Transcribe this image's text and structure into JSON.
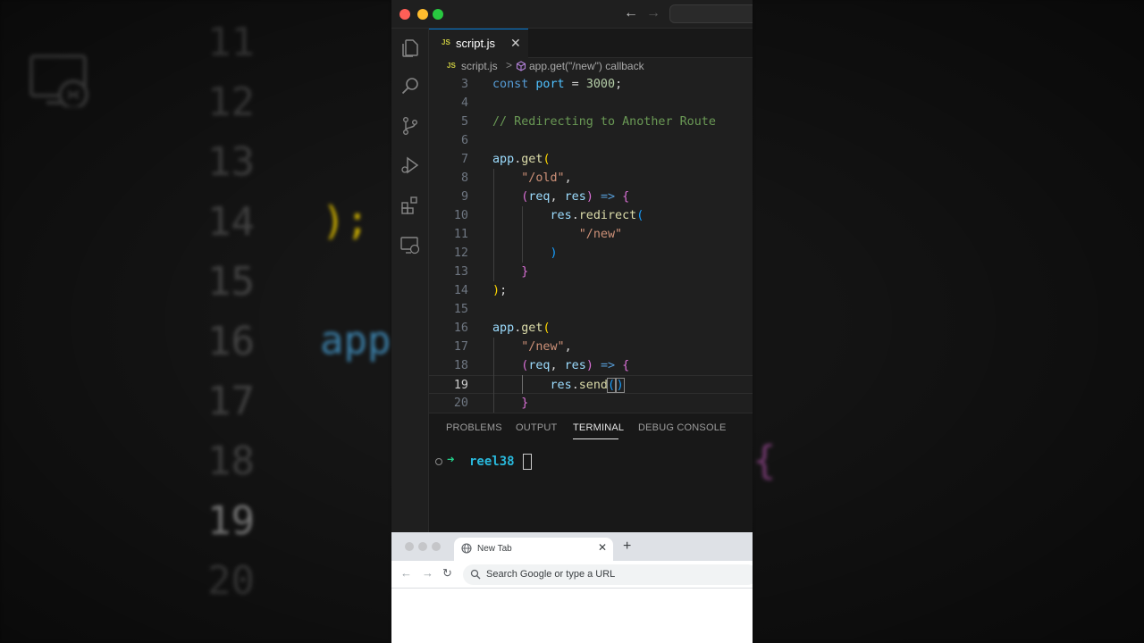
{
  "vscode": {
    "tab_label": "script.js",
    "tab_file_badge": "JS",
    "breadcrumb": {
      "file_badge": "JS",
      "file": "script.js",
      "separator": ">",
      "symbol": "app.get(\"/new\") callback"
    },
    "current_line": 19,
    "code_lines": [
      {
        "n": 3,
        "tokens": [
          [
            "const ",
            "#569cd6"
          ],
          [
            "port",
            "#4fc1ff"
          ],
          [
            " = ",
            "#d4d4d4"
          ],
          [
            "3000",
            "#b5cea8"
          ],
          [
            ";",
            "#d4d4d4"
          ]
        ]
      },
      {
        "n": 4,
        "tokens": []
      },
      {
        "n": 5,
        "tokens": [
          [
            "// Redirecting to Another Route",
            "#6a9955"
          ]
        ]
      },
      {
        "n": 6,
        "tokens": []
      },
      {
        "n": 7,
        "tokens": [
          [
            "app",
            "#9cdcfe"
          ],
          [
            ".",
            "#d4d4d4"
          ],
          [
            "get",
            "#dcdcaa"
          ],
          [
            "(",
            "#ffd700"
          ]
        ]
      },
      {
        "n": 8,
        "tokens": [
          [
            "    ",
            "#d4d4d4"
          ],
          [
            "\"/old\"",
            "#ce9178"
          ],
          [
            ",",
            "#d4d4d4"
          ]
        ]
      },
      {
        "n": 9,
        "tokens": [
          [
            "    ",
            "#d4d4d4"
          ],
          [
            "(",
            "#da70d6"
          ],
          [
            "req",
            "#9cdcfe"
          ],
          [
            ", ",
            "#d4d4d4"
          ],
          [
            "res",
            "#9cdcfe"
          ],
          [
            ")",
            "#da70d6"
          ],
          [
            " ",
            "#d4d4d4"
          ],
          [
            "=>",
            "#569cd6"
          ],
          [
            " ",
            "#d4d4d4"
          ],
          [
            "{",
            "#da70d6"
          ]
        ]
      },
      {
        "n": 10,
        "tokens": [
          [
            "        ",
            "#d4d4d4"
          ],
          [
            "res",
            "#9cdcfe"
          ],
          [
            ".",
            "#d4d4d4"
          ],
          [
            "redirect",
            "#dcdcaa"
          ],
          [
            "(",
            "#179fff"
          ]
        ]
      },
      {
        "n": 11,
        "tokens": [
          [
            "            ",
            "#d4d4d4"
          ],
          [
            "\"/new\"",
            "#ce9178"
          ]
        ]
      },
      {
        "n": 12,
        "tokens": [
          [
            "        ",
            "#d4d4d4"
          ],
          [
            ")",
            "#179fff"
          ]
        ]
      },
      {
        "n": 13,
        "tokens": [
          [
            "    ",
            "#d4d4d4"
          ],
          [
            "}",
            "#da70d6"
          ]
        ]
      },
      {
        "n": 14,
        "tokens": [
          [
            ")",
            "#ffd700"
          ],
          [
            ";",
            "#d4d4d4"
          ]
        ]
      },
      {
        "n": 15,
        "tokens": []
      },
      {
        "n": 16,
        "tokens": [
          [
            "app",
            "#9cdcfe"
          ],
          [
            ".",
            "#d4d4d4"
          ],
          [
            "get",
            "#dcdcaa"
          ],
          [
            "(",
            "#ffd700"
          ]
        ]
      },
      {
        "n": 17,
        "tokens": [
          [
            "    ",
            "#d4d4d4"
          ],
          [
            "\"/new\"",
            "#ce9178"
          ],
          [
            ",",
            "#d4d4d4"
          ]
        ]
      },
      {
        "n": 18,
        "tokens": [
          [
            "    ",
            "#d4d4d4"
          ],
          [
            "(",
            "#da70d6"
          ],
          [
            "req",
            "#9cdcfe"
          ],
          [
            ", ",
            "#d4d4d4"
          ],
          [
            "res",
            "#9cdcfe"
          ],
          [
            ")",
            "#da70d6"
          ],
          [
            " ",
            "#d4d4d4"
          ],
          [
            "=>",
            "#569cd6"
          ],
          [
            " ",
            "#d4d4d4"
          ],
          [
            "{",
            "#da70d6"
          ]
        ]
      },
      {
        "n": 19,
        "tokens": [
          [
            "        ",
            "#d4d4d4"
          ],
          [
            "res",
            "#9cdcfe"
          ],
          [
            ".",
            "#d4d4d4"
          ],
          [
            "send",
            "#dcdcaa"
          ],
          [
            "(",
            "#179fff",
            "box"
          ],
          [
            "|",
            "cursor"
          ],
          [
            ")",
            "#179fff",
            "box"
          ]
        ]
      },
      {
        "n": 20,
        "tokens": [
          [
            "    ",
            "#d4d4d4"
          ],
          [
            "}",
            "#da70d6"
          ]
        ]
      }
    ],
    "panel_tabs": [
      "PROBLEMS",
      "OUTPUT",
      "TERMINAL",
      "DEBUG CONSOLE"
    ],
    "active_panel_tab": "TERMINAL",
    "terminal": {
      "prompt_arrow": "➜",
      "directory": "reel38"
    },
    "icons": {
      "activity_bar": [
        "explorer-icon",
        "search-icon",
        "source-control-icon",
        "run-debug-icon",
        "extensions-icon",
        "remote-explorer-icon"
      ]
    },
    "colors": {
      "accent": "#0078d4",
      "editor_bg": "#1f1f1f",
      "panel_bg": "#181818"
    }
  },
  "chrome": {
    "tab_label": "New Tab",
    "tab_close": "✕",
    "new_tab": "+",
    "omnibox_placeholder": "Search Google or type a URL",
    "nav": {
      "back": "←",
      "forward": "→",
      "reload": "↻"
    }
  },
  "background": {
    "line_numbers": [
      "11",
      "12",
      "13",
      "14",
      "15",
      "16",
      "17",
      "18",
      "19",
      "20"
    ],
    "active_line_number": "19",
    "code_fragments": [
      {
        "text": ");",
        "color": "#d7b800"
      },
      {
        "text": "app",
        "color": "#3b7fa8"
      }
    ],
    "right_fragment": "{"
  }
}
